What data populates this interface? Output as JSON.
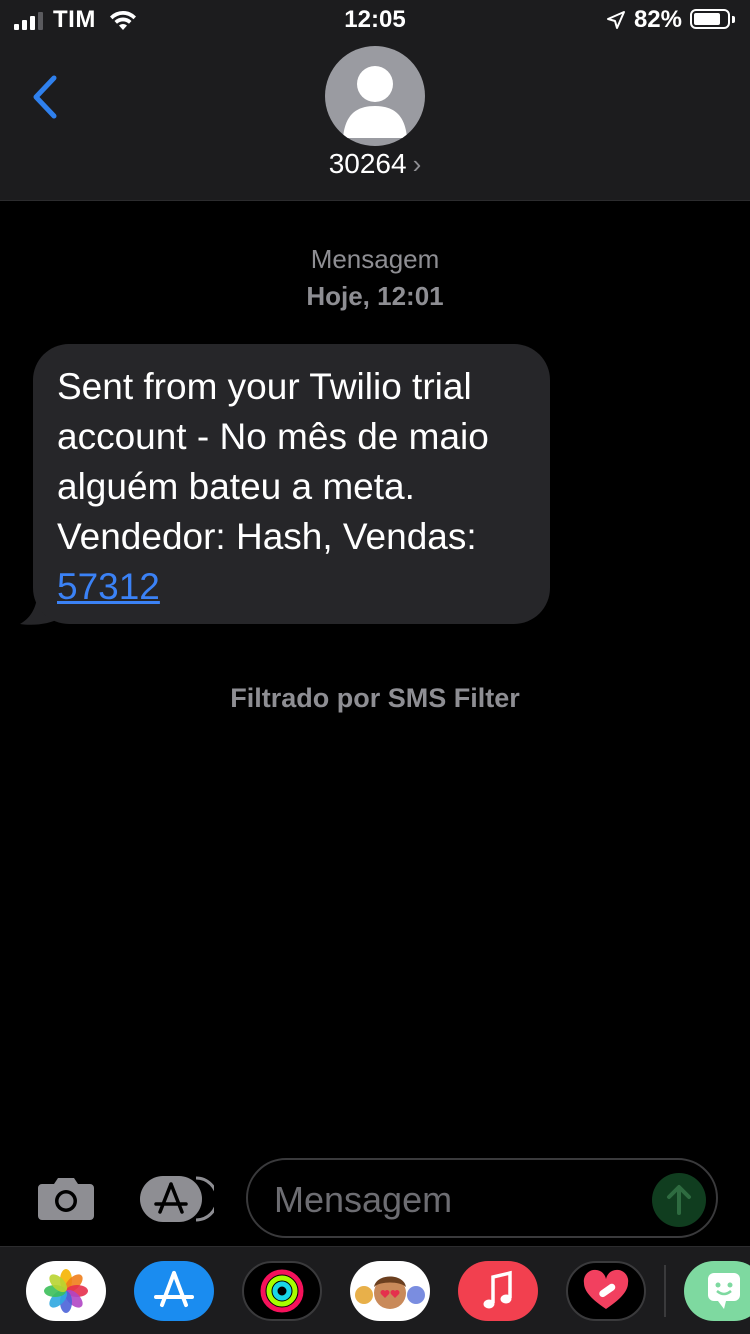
{
  "status_bar": {
    "carrier": "TIM",
    "time": "12:05",
    "battery_percent": "82%",
    "battery_level": 0.82,
    "signal_bars": 3,
    "icons": [
      "signal-icon",
      "wifi-icon",
      "location-arrow-icon",
      "battery-icon"
    ]
  },
  "nav": {
    "back_icon": "chevron-left-icon",
    "contact_name": "30264",
    "contact_chevron": "›",
    "avatar_icon": "person-silhouette-icon"
  },
  "conversation": {
    "message_type": "Mensagem",
    "timestamp": "Hoje, 12:01",
    "messages": [
      {
        "direction": "incoming",
        "text": "Sent from your Twilio trial account - No mês de maio alguém bateu a meta. Vendedor: Hash, Vendas: ",
        "link": "57312"
      }
    ],
    "filter_note": "Filtrado por SMS Filter"
  },
  "input_bar": {
    "placeholder": "Mensagem",
    "icons": [
      "camera-icon",
      "app-store-icon",
      "send-arrow-icon"
    ]
  },
  "app_drawer": {
    "apps": [
      "photos-app-icon",
      "app-store-app-icon",
      "activity-app-icon",
      "memoji-app-icon",
      "music-app-icon",
      "heart-app-icon",
      "chat-app-icon"
    ]
  },
  "colors": {
    "background": "#000000",
    "header": "#1c1c1e",
    "bubble": "#262629",
    "link": "#3b82f6",
    "accent_blue": "#2f80ed",
    "secondary_text": "#8e8e93"
  }
}
